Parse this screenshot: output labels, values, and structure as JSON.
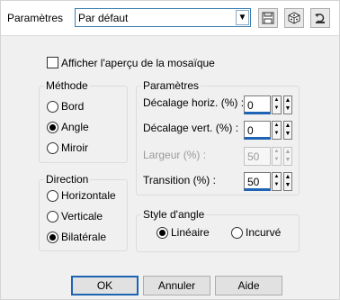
{
  "preset": {
    "label": "Paramètres",
    "value": "Par défaut"
  },
  "toolbar": {
    "icons": [
      "save-icon",
      "randomize-icon",
      "reset-icon"
    ]
  },
  "preview_checkbox": {
    "label": "Afficher l'aperçu de la mosaïque",
    "checked": false
  },
  "method": {
    "title": "Méthode",
    "options": [
      "Bord",
      "Angle",
      "Miroir"
    ],
    "selected": "Angle"
  },
  "direction": {
    "title": "Direction",
    "options": [
      "Horizontale",
      "Verticale",
      "Bilatérale"
    ],
    "selected": "Bilatérale"
  },
  "params": {
    "title": "Paramètres",
    "offset_h": {
      "label": "Décalage horiz. (%) :",
      "value": "0"
    },
    "offset_v": {
      "label": "Décalage vert. (%) :",
      "value": "0"
    },
    "width": {
      "label": "Largeur (%) :",
      "value": "50",
      "enabled": false
    },
    "transition": {
      "label": "Transition (%) :",
      "value": "50"
    }
  },
  "corner_style": {
    "title": "Style d'angle",
    "options": [
      "Linéaire",
      "Incurvé"
    ],
    "selected": "Linéaire"
  },
  "buttons": {
    "ok": "OK",
    "cancel": "Annuler",
    "help": "Aide"
  }
}
